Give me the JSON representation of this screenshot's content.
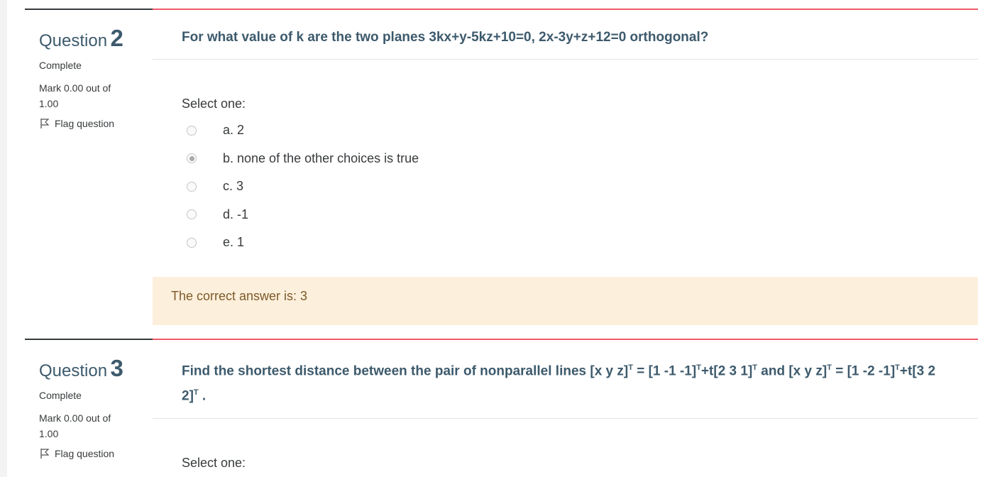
{
  "questions": [
    {
      "word": "Question",
      "number": "2",
      "state": "Complete",
      "grade": "Mark 0.00 out of 1.00",
      "flag_label": "Flag question",
      "text": "For what value of k are the two planes 3kx+y-5kz+10=0, 2x-3y+z+12=0 orthogonal?",
      "select_one": "Select one:",
      "options": [
        {
          "label": "a. 2",
          "checked": false
        },
        {
          "label": "b. none of the other choices is true",
          "checked": true
        },
        {
          "label": "c. 3",
          "checked": false
        },
        {
          "label": "d. -1",
          "checked": false
        },
        {
          "label": "e. 1",
          "checked": false
        }
      ],
      "feedback": "The correct answer is: 3"
    },
    {
      "word": "Question",
      "number": "3",
      "state": "Complete",
      "grade": "Mark 0.00 out of 1.00",
      "flag_label": "Flag question",
      "text_parts": [
        "Find the shortest distance between the pair of nonparallel lines [x  y  z]",
        "T",
        " = [1  -1  -1]",
        "T",
        "+t[2  3  1]",
        "T",
        " and  [x  y  z]",
        "T",
        " = [1  -2  -1]",
        "T",
        "+t[3  2  2]",
        "T",
        " ."
      ],
      "select_one": "Select one:"
    }
  ]
}
